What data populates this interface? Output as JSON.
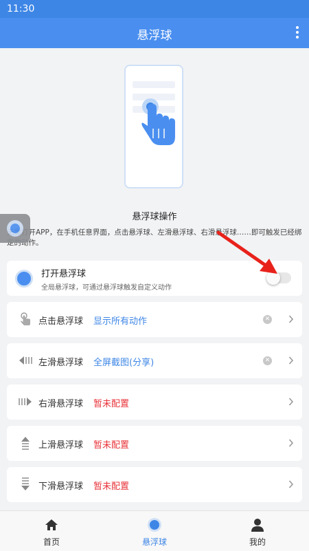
{
  "status_bar": {
    "time": "11:30"
  },
  "app_bar": {
    "title": "悬浮球",
    "more_icon": "more-vertical-icon"
  },
  "section": {
    "title": "悬浮球操作",
    "description": "无需打开APP，在手机任意界面，点击悬浮球、左滑悬浮球、右滑悬浮球……即可触发已经绑定的动作。"
  },
  "toggle": {
    "title": "打开悬浮球",
    "subtitle": "全局悬浮球，可通过悬浮球触发自定义动作",
    "enabled": false
  },
  "actions": [
    {
      "label": "点击悬浮球",
      "value": "显示所有动作",
      "value_color": "blue",
      "clearable": true,
      "icon": "tap-gesture-icon"
    },
    {
      "label": "左滑悬浮球",
      "value": "全屏截图(分享)",
      "value_color": "blue",
      "clearable": true,
      "icon": "swipe-left-icon"
    },
    {
      "label": "右滑悬浮球",
      "value": "暂未配置",
      "value_color": "red",
      "clearable": false,
      "icon": "swipe-right-icon"
    },
    {
      "label": "上滑悬浮球",
      "value": "暂未配置",
      "value_color": "red",
      "clearable": false,
      "icon": "swipe-up-icon"
    },
    {
      "label": "下滑悬浮球",
      "value": "暂未配置",
      "value_color": "red",
      "clearable": false,
      "icon": "swipe-down-icon"
    }
  ],
  "bottom_nav": [
    {
      "label": "首页",
      "icon": "home-icon",
      "active": false
    },
    {
      "label": "悬浮球",
      "icon": "float-ball-icon",
      "active": true
    },
    {
      "label": "我的",
      "icon": "person-icon",
      "active": false
    }
  ],
  "colors": {
    "primary": "#4a8ff0",
    "status_bar": "#3d86e6",
    "value_blue": "#3d86e6",
    "value_red": "#e8333a",
    "background": "#f2f3f5"
  }
}
